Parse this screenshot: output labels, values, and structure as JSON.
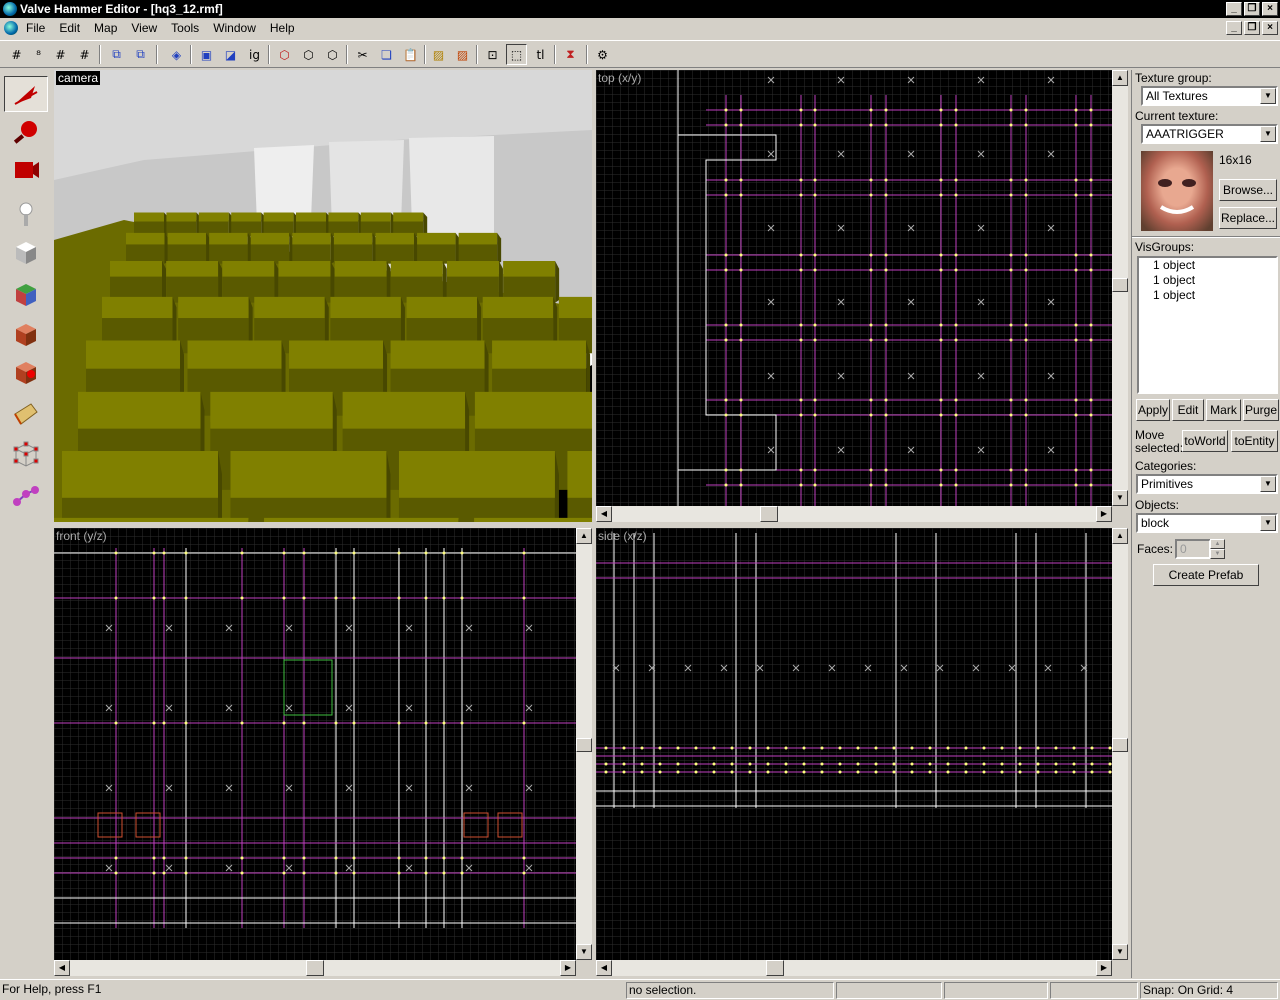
{
  "window": {
    "title": "Valve Hammer Editor - [hq3_12.rmf]"
  },
  "menu": [
    "File",
    "Edit",
    "Map",
    "View",
    "Tools",
    "Window",
    "Help"
  ],
  "toolbar_icons": [
    "grid-toggle-icon",
    "3d-grid-icon",
    "grid-small-icon",
    "grid-large-icon",
    "group-icon",
    "ungroup-icon",
    "hide-icon",
    "carve-icon",
    "hollow-icon",
    "show-all-icon",
    "texture-lock-icon",
    "cut-icon",
    "copy-icon",
    "paste-icon",
    "texture-app-icon",
    "decal-icon",
    "select-all-icon",
    "select-by-handle-icon",
    "toggle-texture-lock-icon",
    "run-map-icon",
    "entity-report-icon"
  ],
  "tools": [
    "selection-tool",
    "magnify-tool",
    "camera-tool",
    "entity-tool",
    "block-tool",
    "texture-app-tool",
    "apply-texture-tool",
    "decal-tool",
    "clipping-tool",
    "vertex-tool",
    "path-tool"
  ],
  "viewports": {
    "camera": {
      "label": "camera"
    },
    "top": {
      "label": "top (x/y)"
    },
    "front": {
      "label": "front (y/z)"
    },
    "side": {
      "label": "side (x/z)"
    }
  },
  "right_panel": {
    "texture_group_label": "Texture group:",
    "texture_group_value": "All Textures",
    "current_texture_label": "Current texture:",
    "current_texture_value": "AAATRIGGER",
    "texture_size": "16x16",
    "browse": "Browse...",
    "replace": "Replace...",
    "visgroups_label": "VisGroups:",
    "visgroups": [
      "1 object",
      "1 object",
      "1 object"
    ],
    "apply": "Apply",
    "edit": "Edit",
    "mark": "Mark",
    "purge": "Purge",
    "move_selected_label_1": "Move",
    "move_selected_label_2": "selected:",
    "to_world": "toWorld",
    "to_entity": "toEntity",
    "categories_label": "Categories:",
    "categories_value": "Primitives",
    "objects_label": "Objects:",
    "objects_value": "block",
    "faces_label": "Faces:",
    "faces_value": "0",
    "create_prefab": "Create Prefab"
  },
  "status": {
    "help": "For Help, press F1",
    "selection": "no selection.",
    "snap": "Snap: On Grid: 4"
  },
  "colors": {
    "grid": "#2a2a2a",
    "brush": "#c040c0",
    "vertex": "#ffffff",
    "crate": "#6b6b00"
  }
}
